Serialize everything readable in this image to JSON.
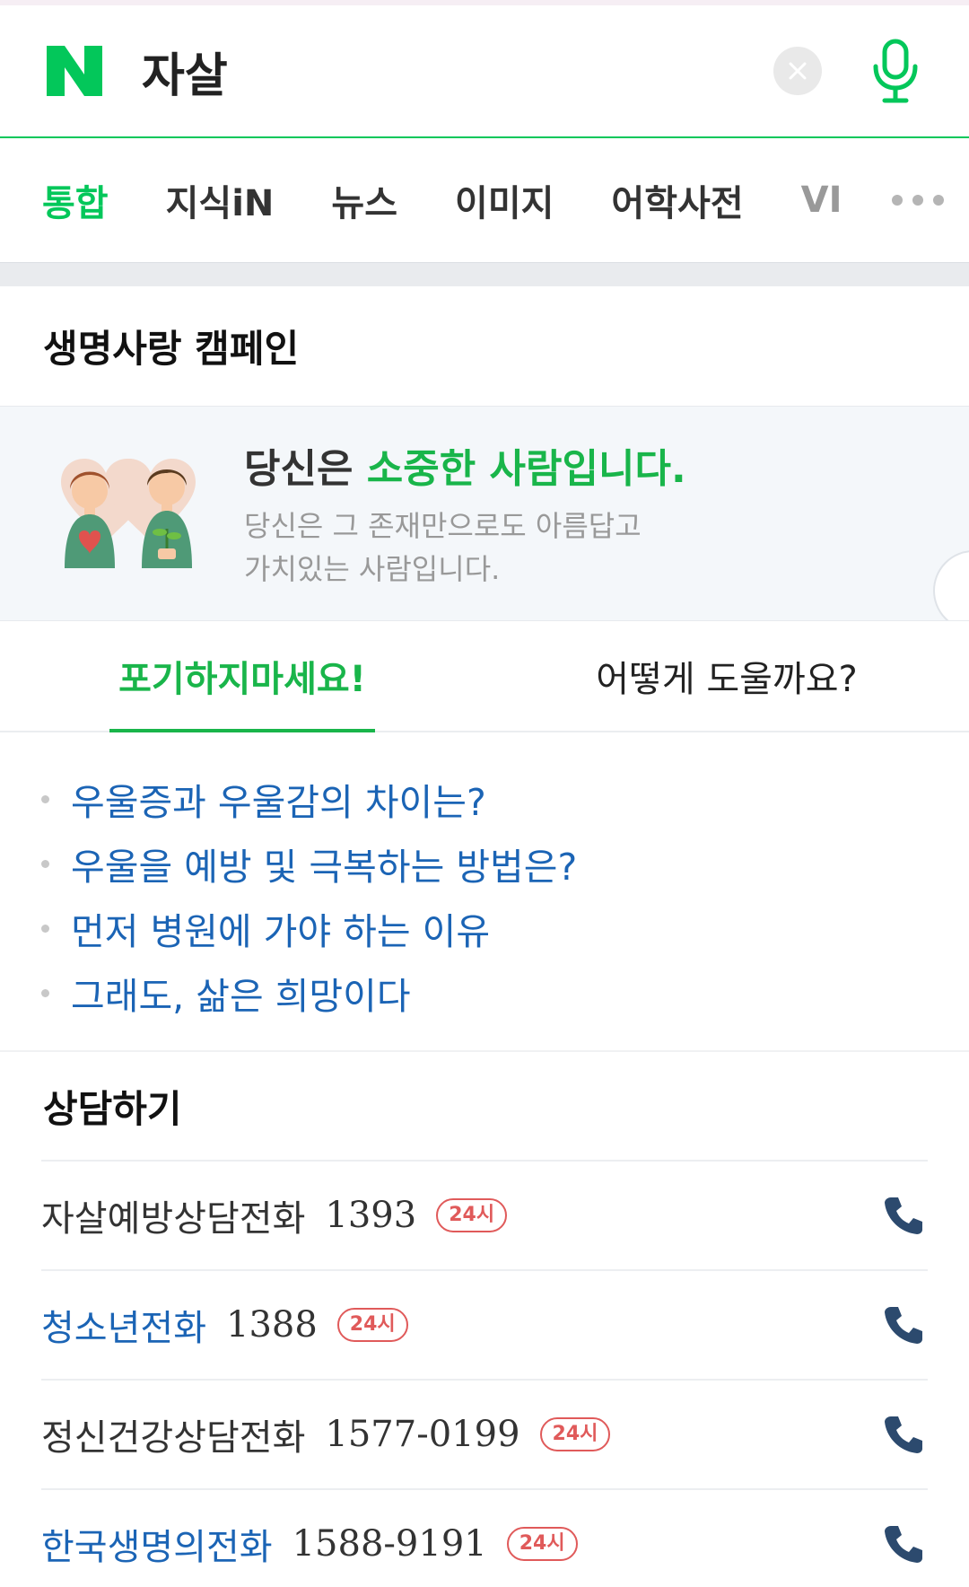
{
  "search": {
    "query": "자살"
  },
  "tabs": [
    {
      "label": "통합",
      "active": true
    },
    {
      "label": "지식iN"
    },
    {
      "label": "뉴스"
    },
    {
      "label": "이미지"
    },
    {
      "label": "어학사전"
    },
    {
      "label": "VI"
    }
  ],
  "campaign": {
    "title": "생명사랑 캠페인",
    "headline_prefix": "당신은",
    "headline_highlight": "소중한 사람입니다.",
    "sub_line1": "당신은 그 존재만으로도 아름답고",
    "sub_line2": "가치있는 사람입니다."
  },
  "subtabs": [
    {
      "label": "포기하지마세요!",
      "active": true
    },
    {
      "label": "어떻게 도울까요?"
    }
  ],
  "links": [
    "우울증과 우울감의 차이는?",
    "우울을 예방 및 극복하는 방법은?",
    "먼저 병원에 가야 하는 이유",
    "그래도, 삶은 희망이다"
  ],
  "counsel": {
    "title": "상담하기",
    "rows": [
      {
        "name": "자살예방상담전화",
        "number": "1393",
        "badge": "24시",
        "link": false
      },
      {
        "name": "청소년전화",
        "number": "1388",
        "badge": "24시",
        "link": true
      },
      {
        "name": "정신건강상담전화",
        "number": "1577-0199",
        "badge": "24시",
        "link": false
      },
      {
        "name": "한국생명의전화",
        "number": "1588-9191",
        "badge": "24시",
        "link": true
      }
    ]
  },
  "colors": {
    "brand_green": "#03c75a",
    "link_blue": "#1b64b5",
    "badge_red": "#e05a5a"
  },
  "icons": [
    "naver-logo-icon",
    "clear-icon",
    "mic-icon",
    "more-icon",
    "phone-icon"
  ]
}
